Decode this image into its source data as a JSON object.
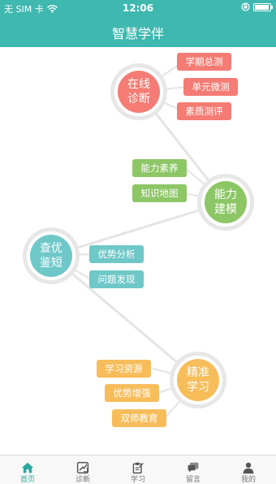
{
  "status": {
    "carrier": "无 SIM 卡",
    "time": "12:06",
    "battery_level": 0.95
  },
  "header": {
    "title": "智慧学伴"
  },
  "colors": {
    "accent": "#3fb8b0",
    "diagnose": "#f47c74",
    "ability": "#8cc665",
    "optimize": "#6fc8c8",
    "learn": "#f7bd5b"
  },
  "map": {
    "nodes": [
      {
        "id": "diagnose",
        "label": "在线诊断",
        "color": "#f47c74"
      },
      {
        "id": "ability",
        "label": "能力建模",
        "color": "#8cc665"
      },
      {
        "id": "optimize",
        "label": "查优鉴短",
        "color": "#6fc8c8"
      },
      {
        "id": "learn",
        "label": "精准学习",
        "color": "#f7bd5b"
      }
    ],
    "tags": [
      {
        "label": "学期总测",
        "node": "diagnose"
      },
      {
        "label": "单元微测",
        "node": "diagnose"
      },
      {
        "label": "素质测评",
        "node": "diagnose"
      },
      {
        "label": "能力素养",
        "node": "ability"
      },
      {
        "label": "知识地图",
        "node": "ability"
      },
      {
        "label": "优势分析",
        "node": "optimize"
      },
      {
        "label": "问题发现",
        "node": "optimize"
      },
      {
        "label": "学习资源",
        "node": "learn"
      },
      {
        "label": "优势增强",
        "node": "learn"
      },
      {
        "label": "双师教育",
        "node": "learn"
      }
    ]
  },
  "tabs": [
    {
      "label": "首页",
      "icon": "home-icon"
    },
    {
      "label": "诊断",
      "icon": "diagnose-icon"
    },
    {
      "label": "学习",
      "icon": "study-icon"
    },
    {
      "label": "留言",
      "icon": "message-icon"
    },
    {
      "label": "我的",
      "icon": "profile-icon"
    }
  ]
}
